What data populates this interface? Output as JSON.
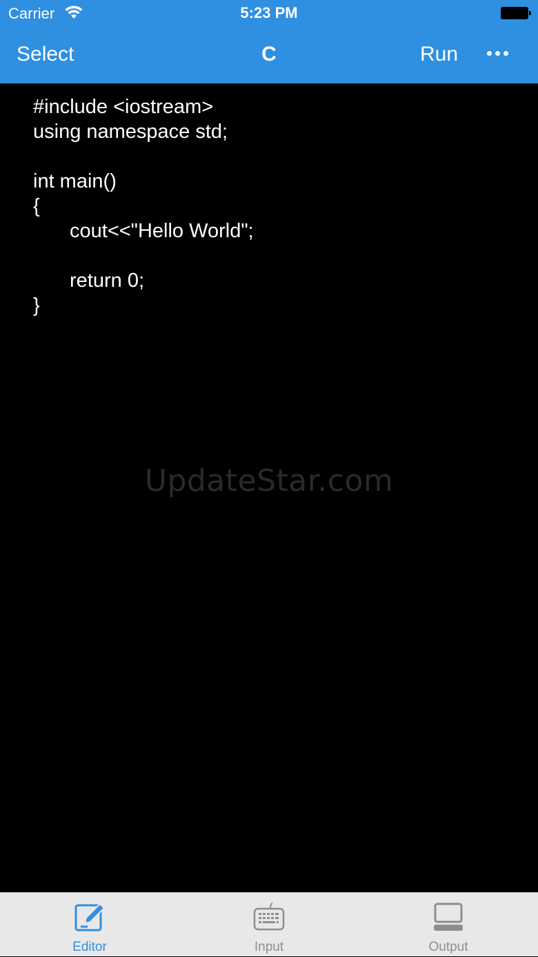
{
  "status_bar": {
    "carrier": "Carrier",
    "time": "5:23 PM"
  },
  "navbar": {
    "left_label": "Select",
    "title": "C",
    "run_label": "Run",
    "more_icon": "ellipsis-icon"
  },
  "editor": {
    "lines": [
      {
        "text": "#include <iostream>"
      },
      {
        "text": "using namespace std;"
      },
      {
        "text": ""
      },
      {
        "text": "int main()"
      },
      {
        "text": "{"
      },
      {
        "text": "cout<<\"Hello World\";"
      },
      {
        "text": ""
      },
      {
        "text": "return 0;"
      },
      {
        "text": "}"
      }
    ],
    "watermark": "UpdateStar.com"
  },
  "tabbar": {
    "tabs": [
      {
        "label": "Editor",
        "icon": "editor-pencil-icon",
        "active": true
      },
      {
        "label": "Input",
        "icon": "keyboard-icon",
        "active": false
      },
      {
        "label": "Output",
        "icon": "computer-icon",
        "active": false
      }
    ]
  },
  "colors": {
    "accent": "#2f8fe0",
    "background": "#000000",
    "tabbar_bg": "#e8e8e8",
    "inactive": "#8e8e8e"
  }
}
